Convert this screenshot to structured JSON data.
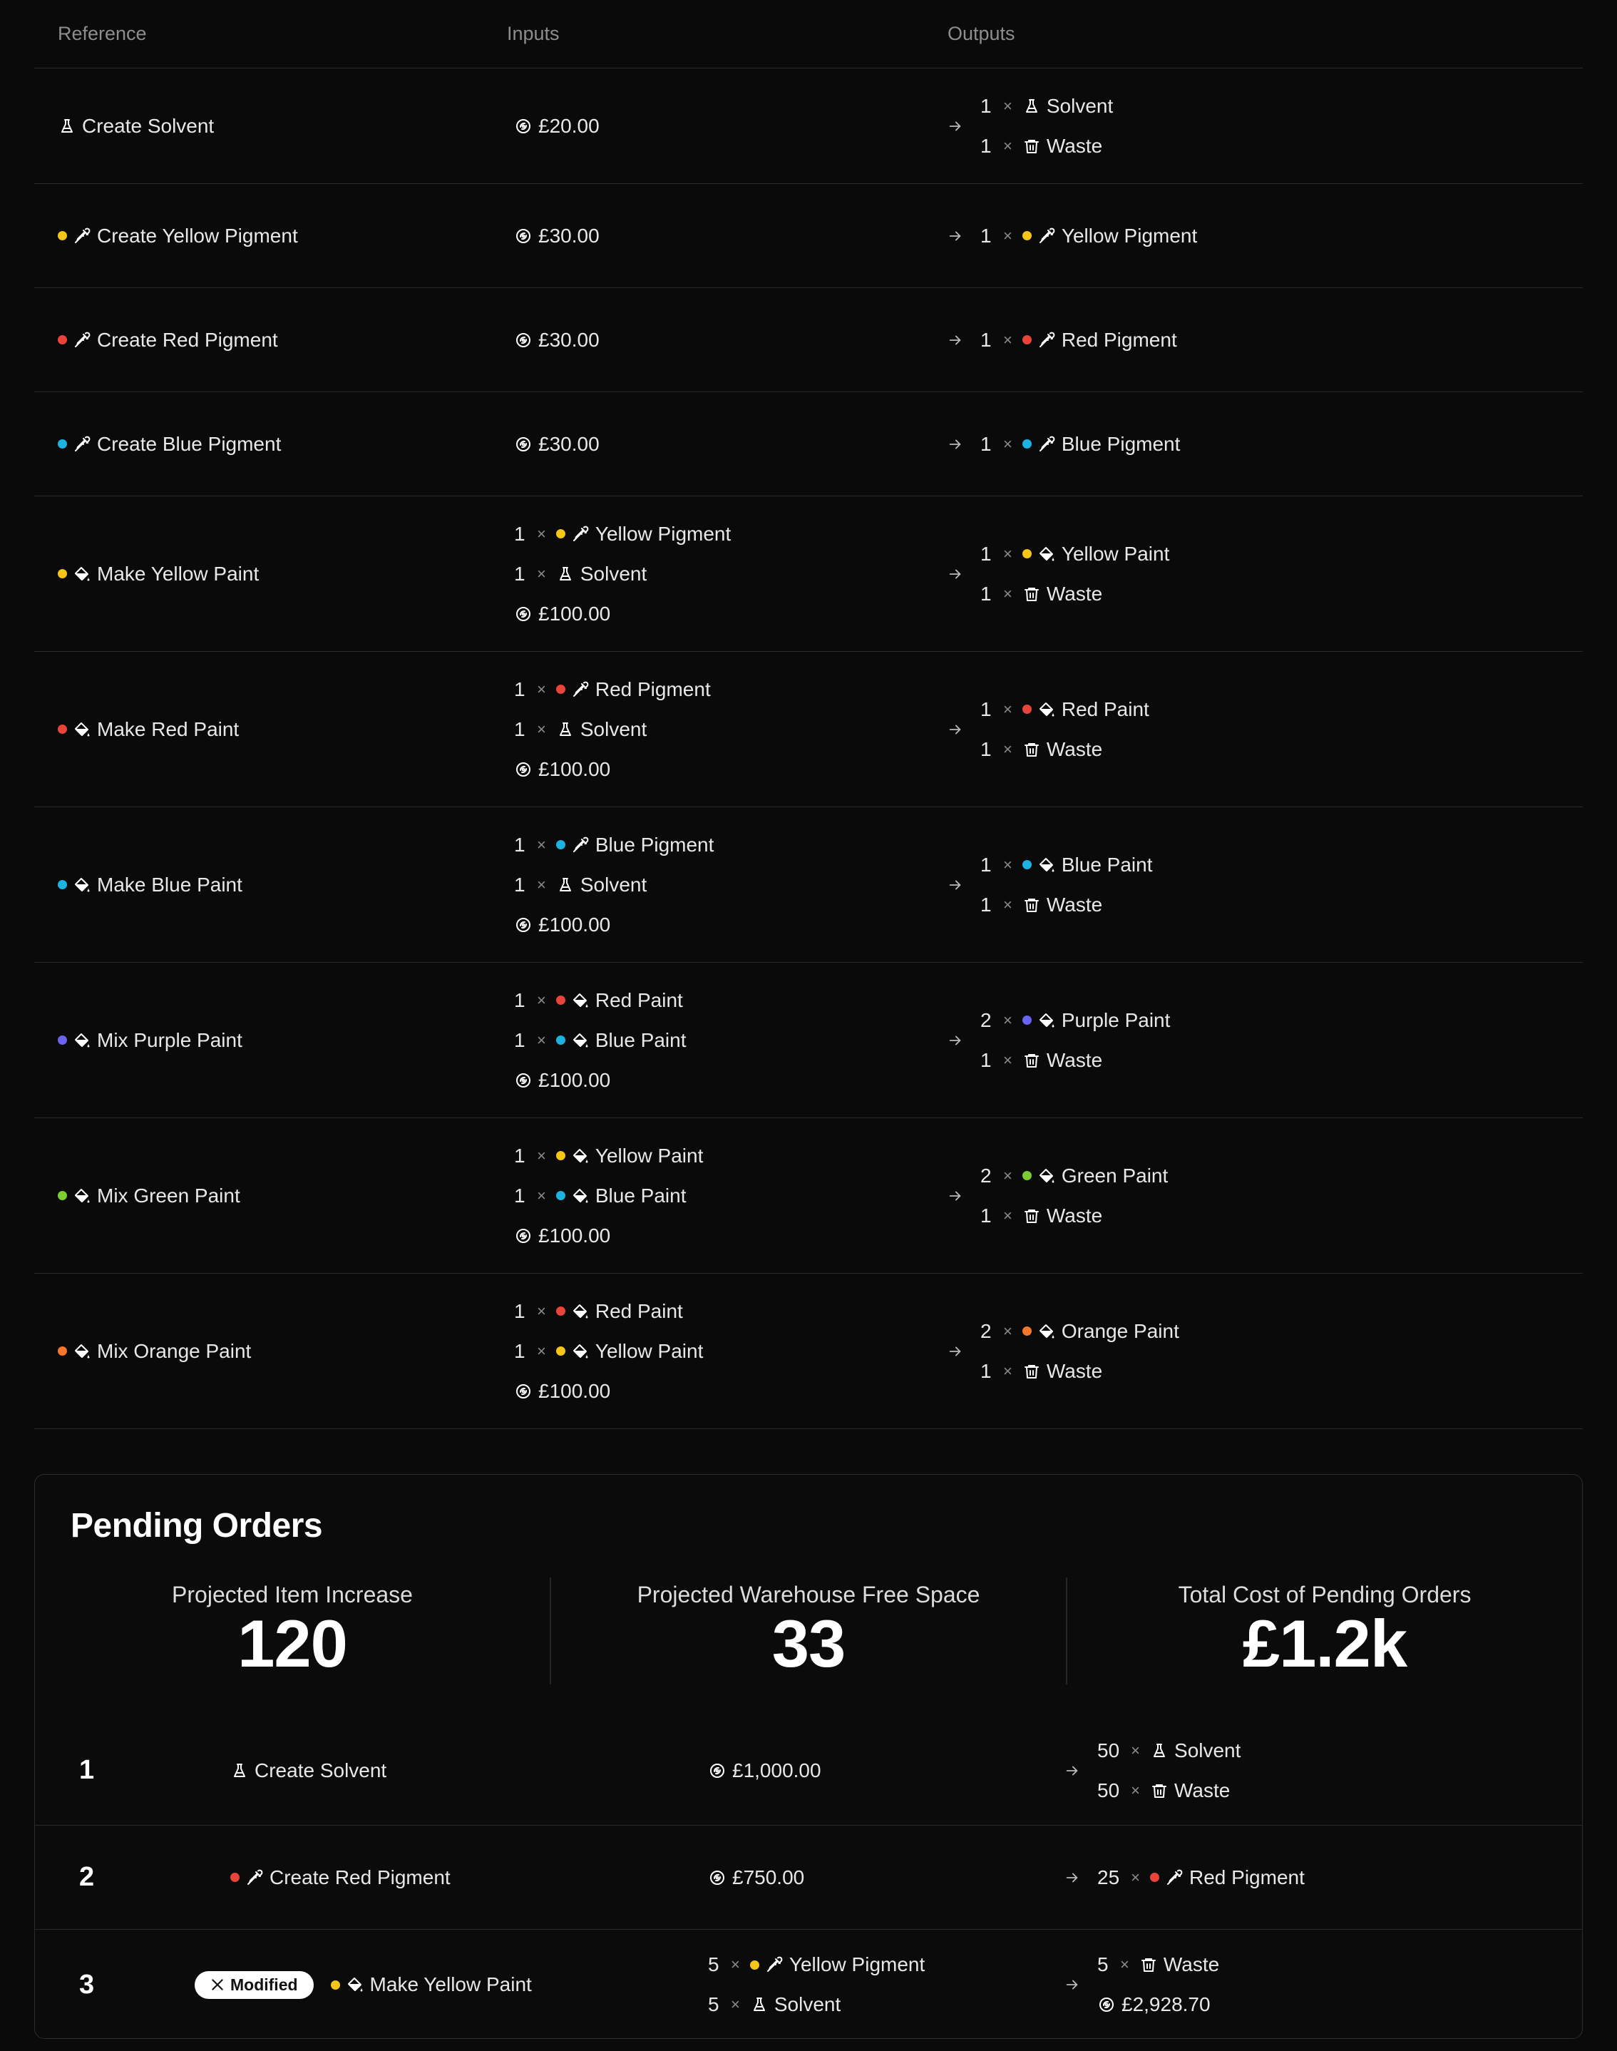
{
  "colors": {
    "yellow": "#f5c518",
    "red": "#e8443a",
    "blue": "#1cb3e0",
    "purple": "#6a64f0",
    "green": "#7ccc34",
    "orange": "#f4772b"
  },
  "table": {
    "headers": {
      "reference": "Reference",
      "inputs": "Inputs",
      "outputs": "Outputs"
    },
    "rows": [
      {
        "ref": "Create Solvent",
        "ref_icon": "flask-icon",
        "ref_color": "",
        "inputs": [
          {
            "qty": "",
            "x": "",
            "name": "£20.00",
            "icon": "coins-icon",
            "color": ""
          }
        ],
        "outputs": [
          {
            "qty": "1",
            "x": "×",
            "name": "Solvent",
            "icon": "flask-icon",
            "color": ""
          },
          {
            "qty": "1",
            "x": "×",
            "name": "Waste",
            "icon": "trash-icon",
            "color": ""
          }
        ]
      },
      {
        "ref": "Create Yellow Pigment",
        "ref_icon": "pipette-icon",
        "ref_color": "yellow",
        "inputs": [
          {
            "qty": "",
            "x": "",
            "name": "£30.00",
            "icon": "coins-icon",
            "color": ""
          }
        ],
        "outputs": [
          {
            "qty": "1",
            "x": "×",
            "name": "Yellow Pigment",
            "icon": "pipette-icon",
            "color": "yellow"
          }
        ]
      },
      {
        "ref": "Create Red Pigment",
        "ref_icon": "pipette-icon",
        "ref_color": "red",
        "inputs": [
          {
            "qty": "",
            "x": "",
            "name": "£30.00",
            "icon": "coins-icon",
            "color": ""
          }
        ],
        "outputs": [
          {
            "qty": "1",
            "x": "×",
            "name": "Red Pigment",
            "icon": "pipette-icon",
            "color": "red"
          }
        ]
      },
      {
        "ref": "Create Blue Pigment",
        "ref_icon": "pipette-icon",
        "ref_color": "blue",
        "inputs": [
          {
            "qty": "",
            "x": "",
            "name": "£30.00",
            "icon": "coins-icon",
            "color": ""
          }
        ],
        "outputs": [
          {
            "qty": "1",
            "x": "×",
            "name": "Blue Pigment",
            "icon": "pipette-icon",
            "color": "blue"
          }
        ]
      },
      {
        "ref": "Make Yellow Paint",
        "ref_icon": "paint-bucket-icon",
        "ref_color": "yellow",
        "inputs": [
          {
            "qty": "1",
            "x": "×",
            "name": "Yellow Pigment",
            "icon": "pipette-icon",
            "color": "yellow"
          },
          {
            "qty": "1",
            "x": "×",
            "name": "Solvent",
            "icon": "flask-icon",
            "color": ""
          },
          {
            "qty": "",
            "x": "",
            "name": "£100.00",
            "icon": "coins-icon",
            "color": ""
          }
        ],
        "outputs": [
          {
            "qty": "1",
            "x": "×",
            "name": "Yellow Paint",
            "icon": "paint-bucket-icon",
            "color": "yellow"
          },
          {
            "qty": "1",
            "x": "×",
            "name": "Waste",
            "icon": "trash-icon",
            "color": ""
          }
        ]
      },
      {
        "ref": "Make Red Paint",
        "ref_icon": "paint-bucket-icon",
        "ref_color": "red",
        "inputs": [
          {
            "qty": "1",
            "x": "×",
            "name": "Red Pigment",
            "icon": "pipette-icon",
            "color": "red"
          },
          {
            "qty": "1",
            "x": "×",
            "name": "Solvent",
            "icon": "flask-icon",
            "color": ""
          },
          {
            "qty": "",
            "x": "",
            "name": "£100.00",
            "icon": "coins-icon",
            "color": ""
          }
        ],
        "outputs": [
          {
            "qty": "1",
            "x": "×",
            "name": "Red Paint",
            "icon": "paint-bucket-icon",
            "color": "red"
          },
          {
            "qty": "1",
            "x": "×",
            "name": "Waste",
            "icon": "trash-icon",
            "color": ""
          }
        ]
      },
      {
        "ref": "Make Blue Paint",
        "ref_icon": "paint-bucket-icon",
        "ref_color": "blue",
        "inputs": [
          {
            "qty": "1",
            "x": "×",
            "name": "Blue Pigment",
            "icon": "pipette-icon",
            "color": "blue"
          },
          {
            "qty": "1",
            "x": "×",
            "name": "Solvent",
            "icon": "flask-icon",
            "color": ""
          },
          {
            "qty": "",
            "x": "",
            "name": "£100.00",
            "icon": "coins-icon",
            "color": ""
          }
        ],
        "outputs": [
          {
            "qty": "1",
            "x": "×",
            "name": "Blue Paint",
            "icon": "paint-bucket-icon",
            "color": "blue"
          },
          {
            "qty": "1",
            "x": "×",
            "name": "Waste",
            "icon": "trash-icon",
            "color": ""
          }
        ]
      },
      {
        "ref": "Mix Purple Paint",
        "ref_icon": "paint-bucket-icon",
        "ref_color": "purple",
        "inputs": [
          {
            "qty": "1",
            "x": "×",
            "name": "Red Paint",
            "icon": "paint-bucket-icon",
            "color": "red"
          },
          {
            "qty": "1",
            "x": "×",
            "name": "Blue Paint",
            "icon": "paint-bucket-icon",
            "color": "blue"
          },
          {
            "qty": "",
            "x": "",
            "name": "£100.00",
            "icon": "coins-icon",
            "color": ""
          }
        ],
        "outputs": [
          {
            "qty": "2",
            "x": "×",
            "name": "Purple Paint",
            "icon": "paint-bucket-icon",
            "color": "purple"
          },
          {
            "qty": "1",
            "x": "×",
            "name": "Waste",
            "icon": "trash-icon",
            "color": ""
          }
        ]
      },
      {
        "ref": "Mix Green Paint",
        "ref_icon": "paint-bucket-icon",
        "ref_color": "green",
        "inputs": [
          {
            "qty": "1",
            "x": "×",
            "name": "Yellow Paint",
            "icon": "paint-bucket-icon",
            "color": "yellow"
          },
          {
            "qty": "1",
            "x": "×",
            "name": "Blue Paint",
            "icon": "paint-bucket-icon",
            "color": "blue"
          },
          {
            "qty": "",
            "x": "",
            "name": "£100.00",
            "icon": "coins-icon",
            "color": ""
          }
        ],
        "outputs": [
          {
            "qty": "2",
            "x": "×",
            "name": "Green Paint",
            "icon": "paint-bucket-icon",
            "color": "green"
          },
          {
            "qty": "1",
            "x": "×",
            "name": "Waste",
            "icon": "trash-icon",
            "color": ""
          }
        ]
      },
      {
        "ref": "Mix Orange Paint",
        "ref_icon": "paint-bucket-icon",
        "ref_color": "orange",
        "inputs": [
          {
            "qty": "1",
            "x": "×",
            "name": "Red Paint",
            "icon": "paint-bucket-icon",
            "color": "red"
          },
          {
            "qty": "1",
            "x": "×",
            "name": "Yellow Paint",
            "icon": "paint-bucket-icon",
            "color": "yellow"
          },
          {
            "qty": "",
            "x": "",
            "name": "£100.00",
            "icon": "coins-icon",
            "color": ""
          }
        ],
        "outputs": [
          {
            "qty": "2",
            "x": "×",
            "name": "Orange Paint",
            "icon": "paint-bucket-icon",
            "color": "orange"
          },
          {
            "qty": "1",
            "x": "×",
            "name": "Waste",
            "icon": "trash-icon",
            "color": ""
          }
        ]
      }
    ]
  },
  "pending": {
    "title": "Pending Orders",
    "stats": [
      {
        "label": "Projected Item Increase",
        "value": "120"
      },
      {
        "label": "Projected Warehouse Free Space",
        "value": "33"
      },
      {
        "label": "Total Cost of Pending Orders",
        "value": "£1.2k"
      }
    ],
    "orders": [
      {
        "num": "1",
        "badge": "",
        "ref": "Create Solvent",
        "ref_icon": "flask-icon",
        "ref_color": "",
        "inputs": [
          {
            "qty": "",
            "x": "",
            "name": "£1,000.00",
            "icon": "coins-icon",
            "color": ""
          }
        ],
        "outputs": [
          {
            "qty": "50",
            "x": "×",
            "name": "Solvent",
            "icon": "flask-icon",
            "color": ""
          },
          {
            "qty": "50",
            "x": "×",
            "name": "Waste",
            "icon": "trash-icon",
            "color": ""
          }
        ]
      },
      {
        "num": "2",
        "badge": "",
        "ref": "Create Red Pigment",
        "ref_icon": "pipette-icon",
        "ref_color": "red",
        "inputs": [
          {
            "qty": "",
            "x": "",
            "name": "£750.00",
            "icon": "coins-icon",
            "color": ""
          }
        ],
        "outputs": [
          {
            "qty": "25",
            "x": "×",
            "name": "Red Pigment",
            "icon": "pipette-icon",
            "color": "red"
          }
        ]
      },
      {
        "num": "3",
        "badge": "Modified",
        "ref": "Make Yellow Paint",
        "ref_icon": "paint-bucket-icon",
        "ref_color": "yellow",
        "inputs": [
          {
            "qty": "5",
            "x": "×",
            "name": "Yellow Pigment",
            "icon": "pipette-icon",
            "color": "yellow"
          },
          {
            "qty": "5",
            "x": "×",
            "name": "Solvent",
            "icon": "flask-icon",
            "color": ""
          }
        ],
        "outputs": [
          {
            "qty": "5",
            "x": "×",
            "name": "Waste",
            "icon": "trash-icon",
            "color": ""
          },
          {
            "qty": "",
            "x": "",
            "name": "£2,928.70",
            "icon": "coins-icon",
            "color": ""
          }
        ]
      }
    ]
  }
}
